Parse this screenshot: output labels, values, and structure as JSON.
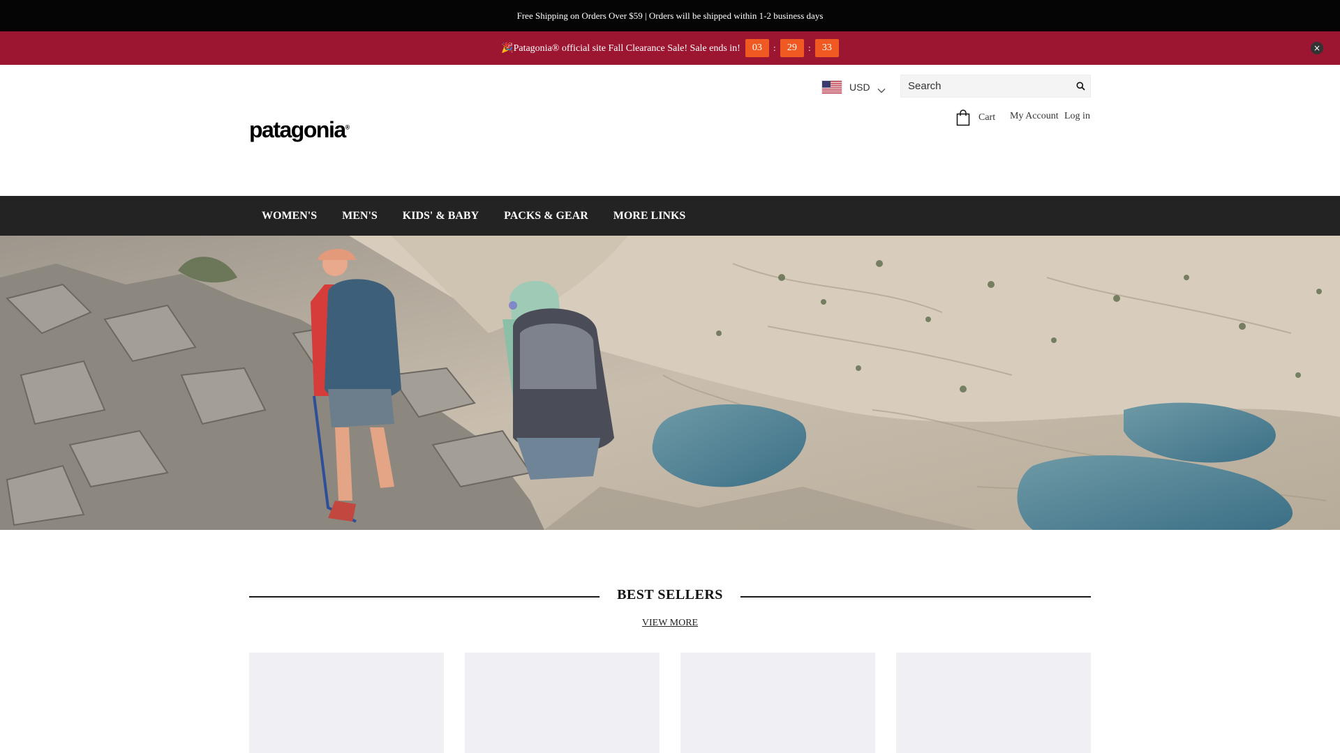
{
  "announcement": {
    "text": "Free Shipping on Orders Over $59 | Orders will be shipped within 1-2 business days"
  },
  "sale_banner": {
    "text": "🎉Patagonia® official site Fall Clearance Sale! Sale ends in!",
    "countdown": {
      "hours": "03",
      "minutes": "29",
      "seconds": "33"
    },
    "separator": ":",
    "close_glyph": "×",
    "accent_color": "#9c1631",
    "countdown_color": "#f05a22"
  },
  "header": {
    "logo": "patagonia",
    "logo_mark": "®",
    "currency": {
      "label": "USD",
      "flag": "us-flag-icon"
    },
    "search": {
      "placeholder": "Search",
      "value": ""
    },
    "cart_label": "Cart",
    "account_label": "My Account",
    "login_label": "Log in"
  },
  "nav": {
    "items": [
      {
        "label": "WOMEN'S"
      },
      {
        "label": "MEN'S"
      },
      {
        "label": "KIDS' & BABY"
      },
      {
        "label": "PACKS & GEAR"
      },
      {
        "label": "MORE LINKS"
      }
    ]
  },
  "hero": {
    "image": "hikers-on-rocky-trail-above-alpine-lakes"
  },
  "best_sellers": {
    "title": "BEST SELLERS",
    "view_more_label": "VIEW MORE",
    "product_count": 4
  }
}
